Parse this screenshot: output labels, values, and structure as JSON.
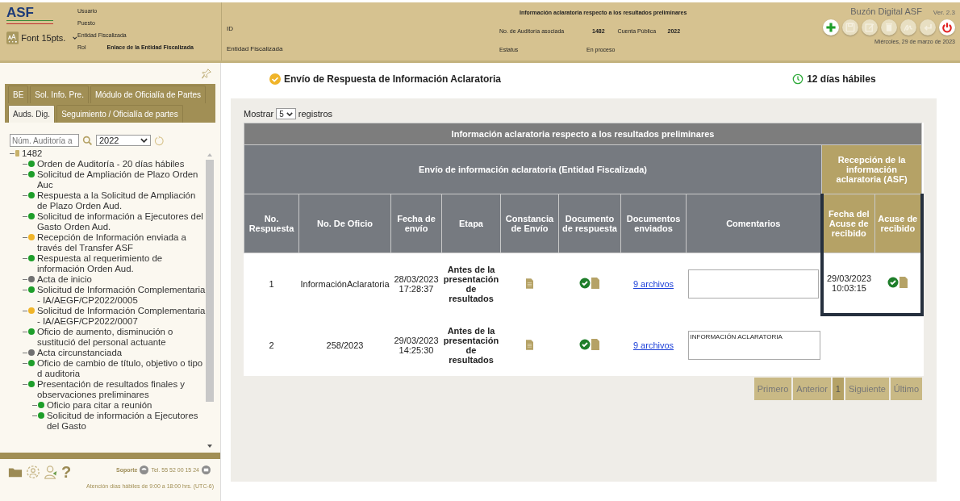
{
  "header": {
    "logo": "ASF",
    "font_select": "Font 15pts.",
    "user_fields": [
      {
        "label": "Usuario"
      },
      {
        "label": "Puesto"
      },
      {
        "label": "Entidad Fiscalizada"
      },
      {
        "label": "Rol",
        "value": "Enlace de la Entidad Fiscalizada"
      }
    ],
    "mid_fields": [
      {
        "label": "ID"
      },
      {
        "label": "Entidad Fiscalizada"
      }
    ],
    "title": "Información aclaratoria respecto a los resultados preliminares",
    "audit_label": "No. de Auditoría asociada",
    "audit_value": "1482",
    "cuenta_label": "Cuenta Pública",
    "cuenta_value": "2022",
    "status_label": "Estatus",
    "status_value": "En proceso",
    "app_name": "Buzón Digital ASF",
    "version": "Ver. 2.3",
    "tools": [
      {
        "kind": "add",
        "disabled": false
      },
      {
        "kind": "save",
        "disabled": true
      },
      {
        "kind": "edit",
        "disabled": true
      },
      {
        "kind": "delete",
        "disabled": true
      },
      {
        "kind": "sign",
        "disabled": true
      },
      {
        "kind": "back",
        "disabled": true
      },
      {
        "kind": "power",
        "disabled": false
      }
    ],
    "date": "Miércoles, 29 de marzo de 2023"
  },
  "sidebar": {
    "tab_rows": [
      [
        {
          "label": "BE",
          "selected": false
        },
        {
          "label": "Sol. Info. Pre.",
          "selected": false
        },
        {
          "label": "Módulo de Oficialía de Partes",
          "selected": false
        }
      ],
      [
        {
          "label": "Auds. Dig.",
          "selected": true
        },
        {
          "label": "Seguimiento / Oficialía de partes",
          "selected": false
        }
      ]
    ],
    "search": {
      "placeholder": "Núm. Auditoría a"
    },
    "year": "2022",
    "tree": [
      {
        "label": "1482",
        "color": "#c8b26a",
        "children": [
          {
            "label": "Orden de Auditoría - 20 días hábiles",
            "color": "#1e9e2a"
          },
          {
            "label": "Solicitud de Ampliación de Plazo Orden Auc",
            "color": "#1e9e2a"
          },
          {
            "label": "Respuesta a la Solicitud de Ampliación de Plazo Orden Aud.",
            "color": "#1e9e2a"
          },
          {
            "label": "Solicitud de información a Ejecutores del Gasto Orden Aud.",
            "color": "#1e9e2a"
          },
          {
            "label": "Recepción de Información enviada a través del Transfer ASF",
            "color": "#f0b429"
          },
          {
            "label": "Respuesta al requerimiento de información Orden Aud.",
            "color": "#1e9e2a"
          },
          {
            "label": "Acta de inicio",
            "color": "#707070"
          },
          {
            "label": "Solicitud de Información Complementaria - IA/AEGF/CP2022/0005",
            "color": "#1e9e2a"
          },
          {
            "label": "Solicitud de Información Complementaria - IA/AEGF/CP2022/0007",
            "color": "#f0b429"
          },
          {
            "label": "Oficio de aumento, disminución o sustitució del personal actuante",
            "color": "#1e9e2a"
          },
          {
            "label": "Acta circunstanciada",
            "color": "#707070"
          },
          {
            "label": "Oficio de cambio de título, objetivo o tipo d auditoria",
            "color": "#1e9e2a"
          },
          {
            "label": "Presentación de resultados finales y observaciones preliminares",
            "color": "#1e9e2a",
            "children": [
              {
                "label": "Oficio para citar a reunión",
                "color": "#1e9e2a"
              },
              {
                "label": "Solicitud de información a Ejecutores del Gasto",
                "color": "#1e9e2a"
              }
            ]
          }
        ]
      }
    ],
    "help_glyph": "?",
    "support_label": "Soporte",
    "phone": "Tel. 55 52 00 15 24",
    "hours": "Atención días hábiles de 9:00 a 18:00 hrs. (UTC-6)"
  },
  "main": {
    "title": "Envío de Respuesta de Información Aclaratoria",
    "days": "12 días hábiles",
    "show_label": "Mostrar",
    "show_value": "5",
    "show_suffix": "registros",
    "table": {
      "caption": "Información aclaratoria respecto a los resultados preliminares",
      "group_left": "Envío de información aclaratoria (Entidad Fiscalizada)",
      "group_right": "Recepción de la información aclaratoria (ASF)",
      "columns": [
        "No. Respuesta",
        "No. De Oficio",
        "Fecha de envío",
        "Etapa",
        "Constancia de Envío",
        "Documento de respuesta",
        "Documentos enviados",
        "Comentarios",
        "Fecha del Acuse de recibido",
        "Acuse de recibido"
      ],
      "rows": [
        {
          "no": "1",
          "oficio": "InformaciónAclaratoria",
          "fecha": "28/03/2023\n17:28:37",
          "etapa": "Antes de la presentación de resultados",
          "respuesta_ok": true,
          "docs": "9 archivos",
          "fecha_acuse": "29/03/2023\n10:03:15",
          "acuse": true,
          "highlighted": true
        },
        {
          "no": "2",
          "oficio": "258/2023",
          "fecha": "29/03/2023\n14:25:30",
          "etapa": "Antes de la presentación de resultados",
          "respuesta_ok": true,
          "docs": "9 archivos",
          "comentario": "INFORMACIÓN ACLARATORIA",
          "acuse": false,
          "highlighted": false
        }
      ]
    },
    "pager": [
      {
        "label": "Primero",
        "selected": false
      },
      {
        "label": "Anterior",
        "selected": false
      },
      {
        "label": "1",
        "selected": true
      },
      {
        "label": "Siguiente",
        "selected": false
      },
      {
        "label": "Último",
        "selected": false
      }
    ]
  }
}
